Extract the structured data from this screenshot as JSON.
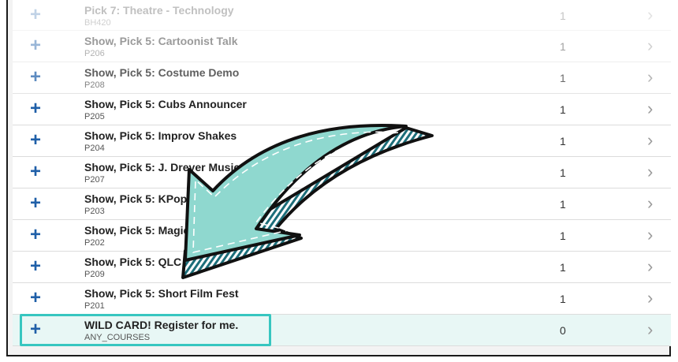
{
  "rows": [
    {
      "title": "Pick 7: Theatre - Technology",
      "code": "BH420",
      "count": "1"
    },
    {
      "title": "Show, Pick 5: Cartoonist Talk",
      "code": "P206",
      "count": "1"
    },
    {
      "title": "Show, Pick 5: Costume Demo",
      "code": "P208",
      "count": "1"
    },
    {
      "title": "Show, Pick 5: Cubs Announcer",
      "code": "P205",
      "count": "1"
    },
    {
      "title": "Show, Pick 5: Improv Shakes",
      "code": "P204",
      "count": "1"
    },
    {
      "title": "Show, Pick 5: J. Drever Music",
      "code": "P207",
      "count": "1"
    },
    {
      "title": "Show, Pick 5: KPop",
      "code": "P203",
      "count": "1"
    },
    {
      "title": "Show, Pick 5: Magic",
      "code": "P202",
      "count": "1"
    },
    {
      "title": "Show, Pick 5: QLC",
      "code": "P209",
      "count": "1"
    },
    {
      "title": "Show, Pick 5: Short Film Fest",
      "code": "P201",
      "count": "1"
    },
    {
      "title": "WILD CARD! Register for me.",
      "code": "ANY_COURSES",
      "count": "0"
    }
  ],
  "icons": {
    "add": "+",
    "chevron": "›"
  },
  "colors": {
    "accent": "#1f5fa8",
    "highlight": "#37c6c0",
    "arrow_fill": "#8fd8cf"
  }
}
